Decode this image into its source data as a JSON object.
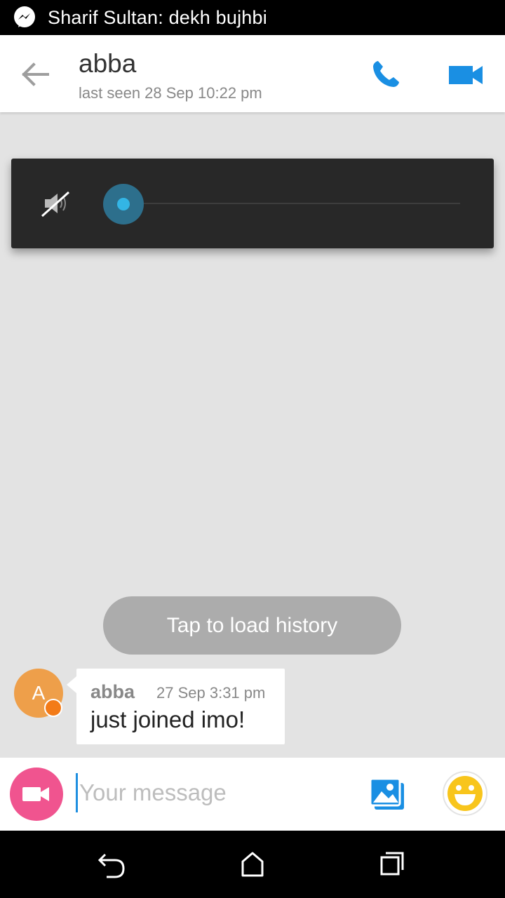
{
  "status_bar": {
    "notification_icon": "messenger-icon",
    "notification_text": "Sharif Sultan: dekh bujhbi"
  },
  "header": {
    "back_icon": "back-arrow-icon",
    "contact_name": "abba",
    "last_seen": "last seen 28 Sep 10:22 pm",
    "call_icon": "phone-icon",
    "video_icon": "video-camera-icon",
    "accent_color": "#1a8fe3"
  },
  "volume_overlay": {
    "icon": "speaker-muted-icon",
    "level": 0
  },
  "history": {
    "load_label": "Tap to load history"
  },
  "messages": [
    {
      "avatar_letter": "A",
      "sender": "abba",
      "time": "27 Sep 3:31 pm",
      "text": "just joined imo!"
    }
  ],
  "composer": {
    "video_icon": "video-camera-icon",
    "placeholder": "Your message",
    "value": "",
    "gallery_icon": "gallery-icon",
    "emoji_icon": "emoji-icon",
    "video_button_color": "#f0548f"
  },
  "nav_bar": {
    "back_icon": "nav-back-icon",
    "home_icon": "nav-home-icon",
    "recents_icon": "nav-recents-icon"
  }
}
